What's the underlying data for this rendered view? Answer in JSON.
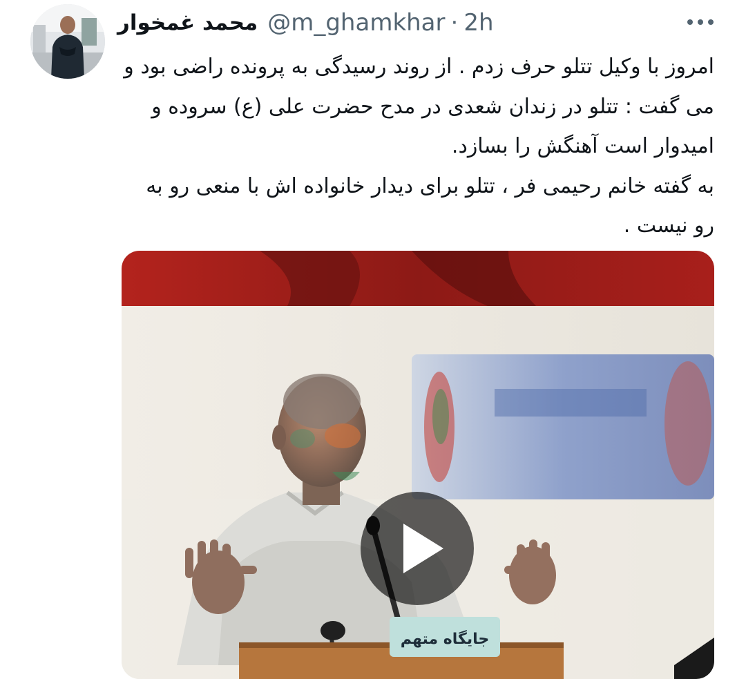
{
  "tweet": {
    "author": {
      "display_name": "محمد غمخوار",
      "handle": "@m_ghamkhar",
      "separator": "·",
      "time_ago": "2h",
      "avatar_icon": "profile-photo"
    },
    "more_icon": "ellipsis-icon",
    "text": "امروز با وکیل تتلو حرف زدم . از روند رسیدگی به پرونده راضی بود و می گفت : تتلو در زندان شعدی در مدح حضرت علی (ع) سروده و امیدوار است آهنگش را بسازد.\nبه گفته خانم رحیمی فر ، تتلو برای دیدار خانواده اش با منعی رو به رو نیست .",
    "media": {
      "type": "video",
      "play_icon": "play-icon",
      "sign_text": "جایگاه متهم"
    }
  },
  "colors": {
    "text_primary": "#0f1419",
    "text_secondary": "#536471",
    "banner_red": "#a3201c",
    "play_overlay": "rgba(0,0,0,0.62)"
  }
}
